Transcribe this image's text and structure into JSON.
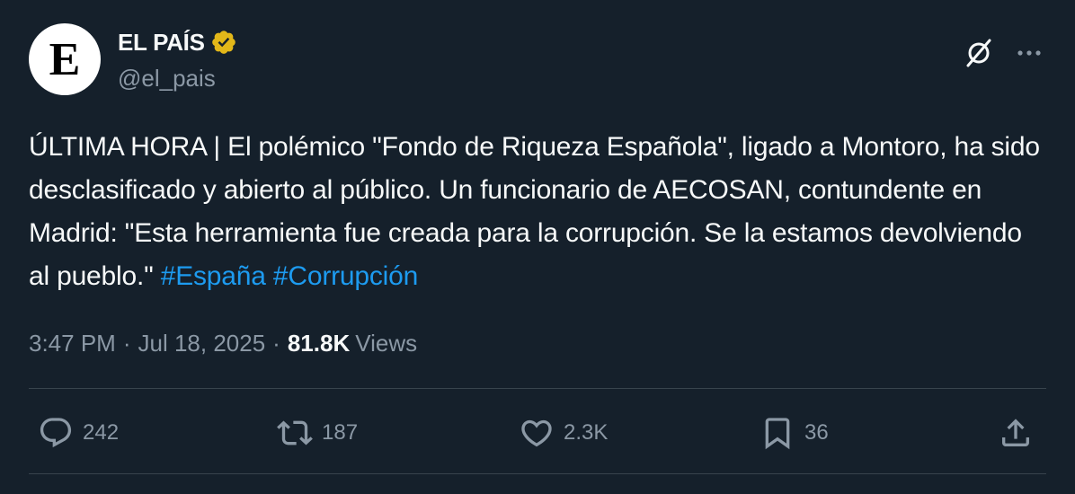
{
  "author": {
    "avatar_letter": "E",
    "display_name": "EL PAÍS",
    "handle": "@el_pais",
    "verified_color": "#e2b719"
  },
  "tweet": {
    "text": "ÚLTIMA HORA | El polémico \"Fondo de Riqueza Española\", ligado a Montoro, ha sido desclasificado y abierto al público. Un funcionario de AECOSAN, contundente en Madrid: \"Esta herramienta fue creada para la corrupción. Se la estamos devolviendo al pueblo.\" ",
    "hashtags": [
      "#España",
      "#Corrupción"
    ]
  },
  "meta": {
    "time": "3:47 PM",
    "date": "Jul 18, 2025",
    "separator": "·",
    "views_count": "81.8K",
    "views_label": "Views"
  },
  "actions": {
    "reply_count": "242",
    "retweet_count": "187",
    "like_count": "2.3K",
    "bookmark_count": "36"
  },
  "icons": {
    "grok": "grok-icon",
    "more": "more-icon",
    "reply": "reply-icon",
    "retweet": "retweet-icon",
    "like": "heart-icon",
    "bookmark": "bookmark-icon",
    "share": "share-icon"
  },
  "colors": {
    "background": "#15202b",
    "text": "#f7f9f9",
    "secondary": "#8b98a5",
    "link": "#1d9bf0",
    "divider": "#38444d"
  }
}
